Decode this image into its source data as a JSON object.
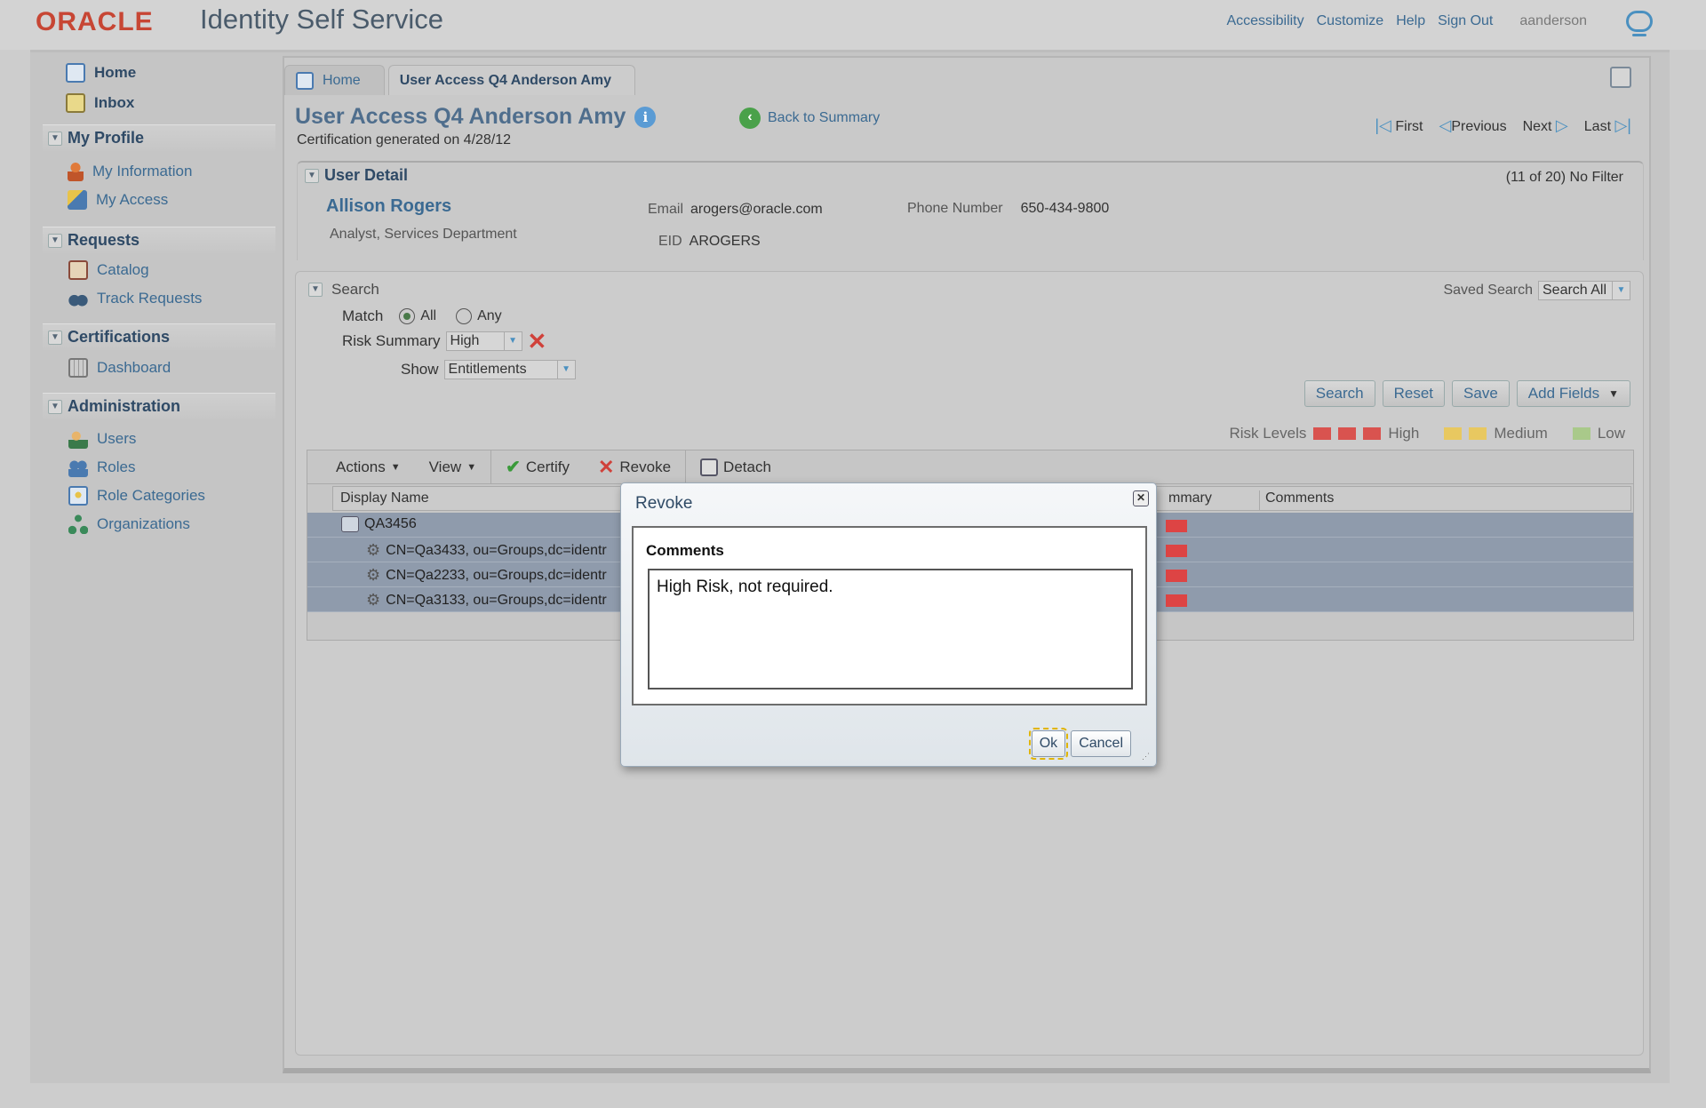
{
  "header": {
    "logo": "ORACLE",
    "app_title": "Identity Self Service",
    "links": [
      "Accessibility",
      "Customize",
      "Help",
      "Sign Out"
    ],
    "user": "aanderson"
  },
  "sidebar": {
    "home": "Home",
    "inbox": "Inbox",
    "sections": {
      "profile": {
        "title": "My Profile",
        "items": [
          "My Information",
          "My Access"
        ]
      },
      "requests": {
        "title": "Requests",
        "items": [
          "Catalog",
          "Track Requests"
        ]
      },
      "certifications": {
        "title": "Certifications",
        "items": [
          "Dashboard"
        ]
      },
      "administration": {
        "title": "Administration",
        "items": [
          "Users",
          "Roles",
          "Role Categories",
          "Organizations"
        ]
      }
    }
  },
  "tabs": [
    "Home",
    "User Access Q4 Anderson Amy"
  ],
  "page": {
    "title": "User Access Q4 Anderson Amy",
    "subtitle": "Certification generated on 4/28/12",
    "back_link": "Back to Summary",
    "pager": [
      "First",
      "Previous",
      "Next",
      "Last"
    ]
  },
  "user_detail": {
    "heading": "User Detail",
    "count": "(11 of 20) No Filter",
    "name": "Allison Rogers",
    "department": "Analyst, Services Department",
    "email_label": "Email",
    "email": "arogers@oracle.com",
    "eid_label": "EID",
    "eid": "AROGERS",
    "phone_label": "Phone Number",
    "phone": "650-434-9800"
  },
  "search": {
    "heading": "Search",
    "saved_search_label": "Saved Search",
    "saved_search_value": "Search All",
    "match_label": "Match",
    "match_options": [
      "All",
      "Any"
    ],
    "match_selected": "All",
    "risk_label": "Risk Summary",
    "risk_value": "High",
    "show_label": "Show",
    "show_value": "Entitlements",
    "buttons": [
      "Search",
      "Reset",
      "Save",
      "Add Fields"
    ]
  },
  "risk_levels": {
    "label": "Risk Levels",
    "high": "High",
    "medium": "Medium",
    "low": "Low",
    "colors": {
      "high": "#d9534f",
      "medium": "#e8c860",
      "low": "#a9c98a"
    }
  },
  "table": {
    "toolbar": {
      "actions": "Actions",
      "view": "View",
      "certify": "Certify",
      "revoke": "Revoke",
      "detach": "Detach"
    },
    "columns": {
      "display_name": "Display Name",
      "summary_partial": "mmary",
      "comments": "Comments"
    },
    "rows": [
      {
        "name": "QA3456"
      },
      {
        "name": "CN=Qa3433, ou=Groups,dc=identr"
      },
      {
        "name": "CN=Qa2233, ou=Groups,dc=identr"
      },
      {
        "name": "CN=Qa3133, ou=Groups,dc=identr"
      }
    ]
  },
  "dialog": {
    "title": "Revoke",
    "comments_label": "Comments",
    "comments_value": "High Risk, not required.",
    "ok": "Ok",
    "cancel": "Cancel"
  }
}
